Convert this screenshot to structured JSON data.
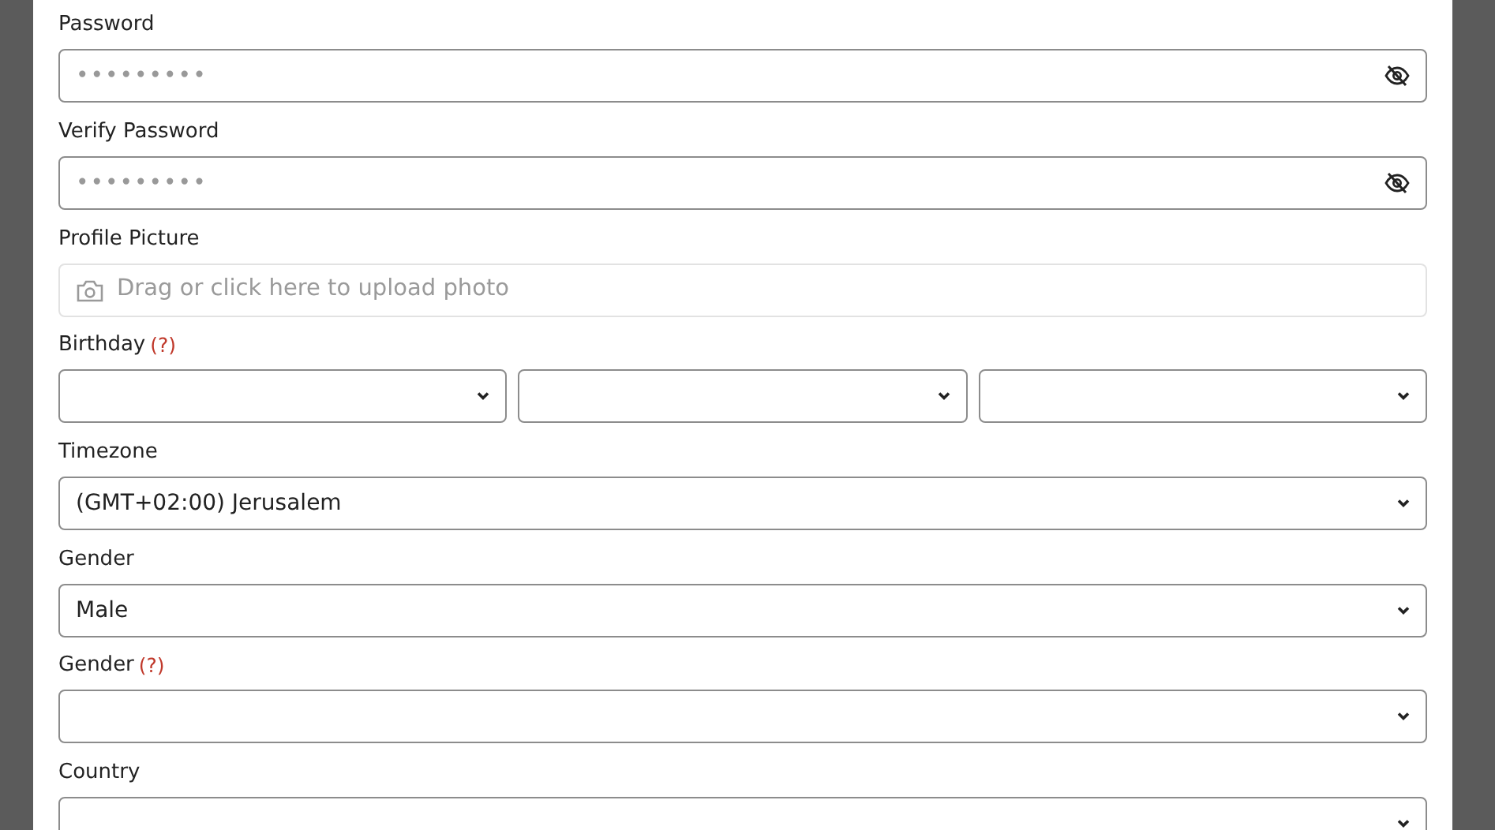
{
  "fields": [
    {
      "kind": "password",
      "label": "Password",
      "mask": "•••••••••"
    },
    {
      "kind": "password",
      "label": "Verify Password",
      "mask": "•••••••••"
    },
    {
      "kind": "upload",
      "label": "Profile Picture",
      "placeholder": "Drag or click here to upload photo"
    },
    {
      "kind": "selects",
      "label": "Birthday",
      "help": "(?)",
      "selects": [
        {
          "kind": "dropdown"
        },
        {
          "kind": "dropdown"
        },
        {
          "kind": "dropdown"
        }
      ]
    },
    {
      "kind": "selects",
      "label": "Timezone",
      "selects": [
        {
          "kind": "dropdown",
          "value": "(GMT+02:00) Jerusalem"
        }
      ]
    },
    {
      "kind": "selects",
      "label": "Gender",
      "selects": [
        {
          "kind": "dropdown",
          "value": "Male"
        }
      ]
    },
    {
      "kind": "selects",
      "label": "Gender",
      "help": "(?)",
      "selects": [
        {
          "kind": "dropdown"
        }
      ]
    },
    {
      "kind": "selects",
      "label": "Country",
      "selects": [
        {
          "kind": "dropdown"
        }
      ]
    }
  ]
}
